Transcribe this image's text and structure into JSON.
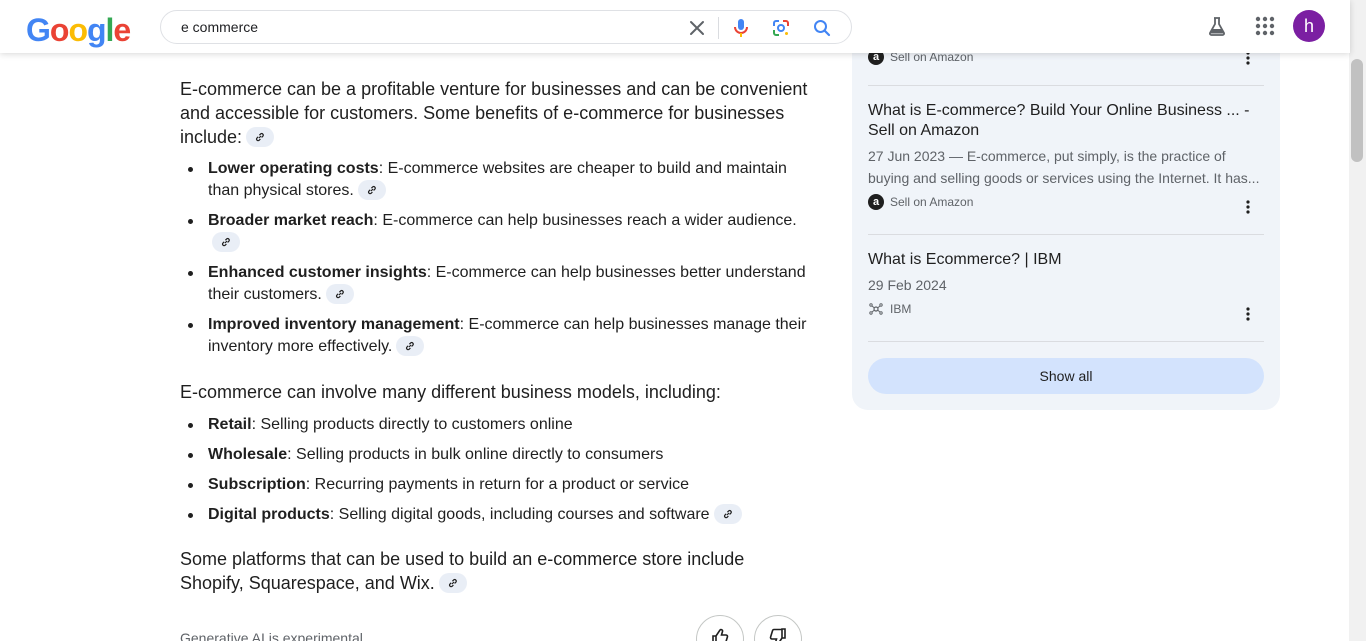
{
  "header": {
    "logo_letters": [
      "G",
      "o",
      "o",
      "g",
      "l",
      "e"
    ],
    "logo_colors": [
      "#4285f4",
      "#ea4335",
      "#fbbc05",
      "#4285f4",
      "#34a853",
      "#ea4335"
    ],
    "search_value": "e commerce",
    "icons": [
      "close-icon",
      "mic-icon",
      "lens-icon",
      "search-icon",
      "labs-flask-icon",
      "apps-grid-icon"
    ],
    "avatar_letter": "h",
    "avatar_color": "#7b1fa2"
  },
  "main": {
    "intro": "E-commerce can be a profitable venture for businesses and can be convenient and accessible for customers. Some benefits of e-commerce for businesses include:",
    "benefits": [
      {
        "term": "Lower operating costs",
        "text": ": E-commerce websites are cheaper to build and maintain than physical stores."
      },
      {
        "term": "Broader market reach",
        "text": ": E-commerce can help businesses reach a wider audience."
      },
      {
        "term": "Enhanced customer insights",
        "text": ": E-commerce can help businesses better understand their customers."
      },
      {
        "term": "Improved inventory management",
        "text": ": E-commerce can help businesses manage their inventory more effectively."
      }
    ],
    "models_heading": "E-commerce can involve many different business models, including:",
    "models": [
      {
        "term": "Retail",
        "text": ": Selling products directly to customers online"
      },
      {
        "term": "Wholesale",
        "text": ": Selling products in bulk online directly to consumers"
      },
      {
        "term": "Subscription",
        "text": ": Recurring payments in return for a product or service"
      },
      {
        "term": "Digital products",
        "text": ": Selling digital goods, including courses and software"
      }
    ],
    "platforms": "Some platforms that can be used to build an e-commerce store include Shopify, Squarespace, and Wix.",
    "experimental_note": "Generative AI is experimental"
  },
  "sources": {
    "top_site": "Sell on Amazon",
    "items": [
      {
        "title": "What is E-commerce? Build Your Online Business ... - Sell on Amazon",
        "date_snippet": "27 Jun 2023 — E-commerce, put simply, is the practice of buying and selling goods or services using the Internet. It has...",
        "site": "Sell on Amazon",
        "site_icon": "a"
      },
      {
        "title": "What is Ecommerce? | IBM",
        "date": "29 Feb 2024",
        "site": "IBM"
      }
    ],
    "show_all_label": "Show all"
  }
}
